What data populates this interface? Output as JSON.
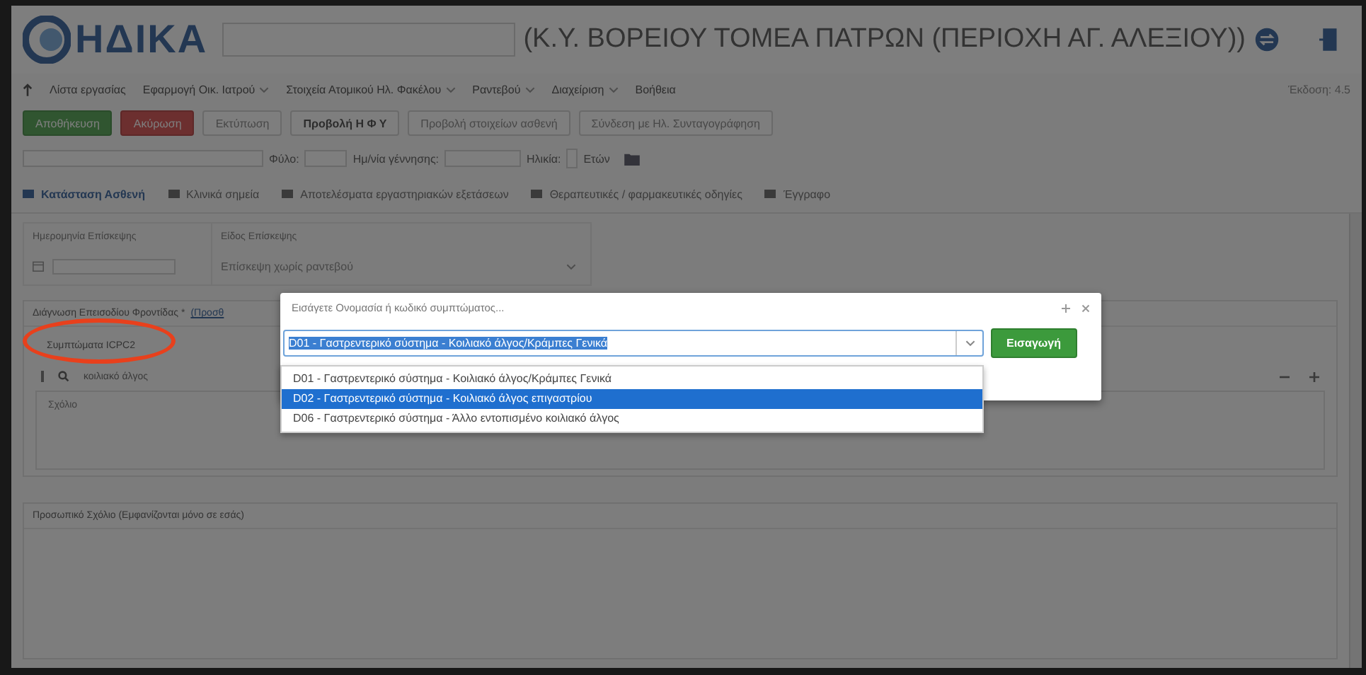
{
  "header": {
    "logo": "ΗΔΙΚΑ",
    "title": "(Κ.Υ. ΒΟΡΕΙΟΥ ΤΟΜΕΑ ΠΑΤΡΩΝ (ΠΕΡΙΟΧΗ ΑΓ. ΑΛΕΞΙΟΥ))"
  },
  "menu": {
    "items": [
      {
        "label": "Λίστα εργασίας",
        "dropdown": false
      },
      {
        "label": "Εφαρμογή Οικ. Ιατρού",
        "dropdown": true
      },
      {
        "label": "Στοιχεία Ατομικού Ηλ. Φακέλου",
        "dropdown": true
      },
      {
        "label": "Ραντεβού",
        "dropdown": true
      },
      {
        "label": "Διαχείριση",
        "dropdown": true
      },
      {
        "label": "Βοήθεια",
        "dropdown": false
      }
    ],
    "version": "Έκδοση: 4.5"
  },
  "toolbar": [
    {
      "label": "Αποθήκευση",
      "kind": "success",
      "disabled": false
    },
    {
      "label": "Ακύρωση",
      "kind": "danger",
      "disabled": false
    },
    {
      "label": "Εκτύπωση",
      "kind": "default",
      "disabled": true
    },
    {
      "label": "Προβολή Η Φ Υ",
      "kind": "default",
      "disabled": false
    },
    {
      "label": "Προβολή στοιχείων ασθενή",
      "kind": "default",
      "disabled": true
    },
    {
      "label": "Σύνδεση με Ηλ. Συνταγογράφηση",
      "kind": "default",
      "disabled": true
    }
  ],
  "patient": {
    "sex_label": "Φύλο:",
    "birth_label": "Ημ/νία γέννησης:",
    "age_label": "Ηλικία:",
    "age_unit": "Ετών"
  },
  "tabs": [
    {
      "label": "Κατάσταση Ασθενή",
      "selected": true
    },
    {
      "label": "Κλινικά σημεία",
      "selected": false
    },
    {
      "label": "Αποτελέσματα εργαστηριακών εξετάσεων",
      "selected": false
    },
    {
      "label": "Θεραπευτικές / φαρμακευτικές οδηγίες",
      "selected": false
    },
    {
      "label": "Έγγραφο",
      "selected": false
    }
  ],
  "visit": {
    "date_label": "Ημερομηνία Επίσκεψης",
    "type_label": "Είδος Επίσκεψης",
    "type_value": "Επίσκεψη χωρίς ραντεβού"
  },
  "diagnosis": {
    "title": "Διάγνωση Επεισοδίου Φροντίδας *",
    "link": "(Προσθ",
    "symptoms_label": "Συμπτώματα ICPC2",
    "search_value": "κοιλιακό άλγος",
    "comment_label": "Σχόλιο"
  },
  "personal_comment": {
    "label": "Προσωπικό Σχόλιο (Εμφανίζονται μόνο σε εσάς)"
  },
  "modal": {
    "title": "Εισάγετε Ονομασία ή κωδικό συμπτώματος...",
    "selected_value": "D01 - Γαστρεντερικό σύστημα - Κοιλιακό άλγος/Κράμπες Γενικά",
    "button": "Εισαγωγή",
    "options": [
      {
        "label": "D01 - Γαστρεντερικό σύστημα - Κοιλιακό άλγος/Κράμπες Γενικά",
        "selected": false
      },
      {
        "label": "D02 - Γαστρεντερικό σύστημα - Κοιλιακό άλγος επιγαστρίου",
        "selected": true
      },
      {
        "label": "D06 - Γαστρεντερικό σύστημα - Άλλο εντοπισμένο κοιλιακό άλγος",
        "selected": false
      }
    ]
  }
}
